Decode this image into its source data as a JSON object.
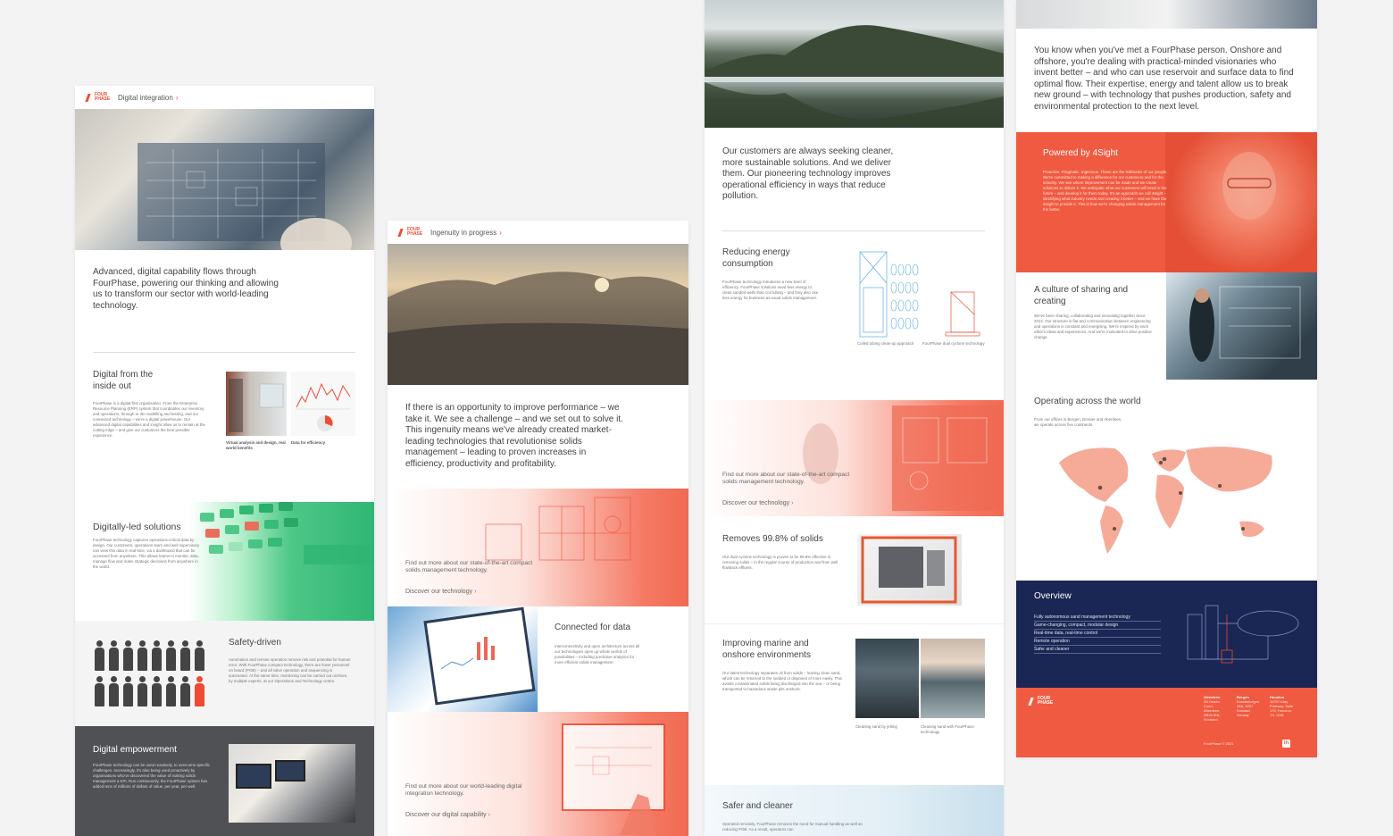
{
  "brand": {
    "logo_text": "FOUR PHASE",
    "accent": "#ee4b33",
    "navy": "#1a2653"
  },
  "col1": {
    "crumb": "Digital integration",
    "lead": "Advanced, digital capability flows through FourPhase, powering our thinking and allowing us to transform our sector with world-leading technology.",
    "digital_inside": {
      "title": "Digital from the inside out",
      "body": "FourPhase is a digital-first organisation. From the Enterprise Resource Planning (ERP) system that coordinates our inventory and operations, through to 3D modelling and testing, and our connected technology – we're a digital powerhouse. Our advanced digital capabilities and insight allow us to remain at the cutting edge – and give our customers the best possible experience.",
      "caption1_title": "Virtual analysis and design, real world benefits",
      "caption2_title": "Data for efficiency"
    },
    "solutions": {
      "title": "Digitally-led solutions",
      "body": "FourPhase technology captures operations-critical data by design. Our customers, operations team and well supervisory can view this data in real-time, via a dashboard that can be accessed from anywhere. This allows teams to monitor, data, manage flow and make strategic decisions from anywhere in the world."
    },
    "safety": {
      "title": "Safety-driven",
      "body": "Automation and remote operation remove risk and potential for human error. With FourPhase compact technology, there are fewer personnel on board (POB) – and all valve operation and sequencing is automated. At the same time, monitoring can be carried out onshore, by multiple experts, at our Operations and Technology centre."
    },
    "empowerment": {
      "title": "Digital empowerment",
      "body": "FourPhase technology can be used reactively, to overcome specific challenges. Increasingly, it's also being used proactively by organisations who've discovered the value of making solids management a KPI. Run continuously, the FourPhase system has added tens of millions of dollars of value, per year, per well."
    }
  },
  "col2": {
    "crumb": "Ingenuity in progress",
    "lead": "If there is an opportunity to improve performance – we take it. We see a challenge – and we set out to solve it. This ingenuity means we've already created market-leading technologies that revolutionise solids management – leading to proven increases in efficiency, productivity and profitability.",
    "promo1": {
      "text": "Find out more about our state-of-the-art compact solids management technology.",
      "link": "Discover our technology"
    },
    "connected": {
      "title": "Connected for data",
      "body": "Interconnectivity and open architecture across all our technologies open up whole worlds of possibilities – including predictive analytics for more efficient solids management."
    },
    "promo2": {
      "text": "Find out more about our world-leading digital integration technology.",
      "link": "Discover our digital capability"
    }
  },
  "col3": {
    "lead": "Our customers are always seeking cleaner, more sustainable solutions. And we deliver them. Our pioneering technology improves operational efficiency in ways that reduce pollution.",
    "energy": {
      "title": "Reducing energy consumption",
      "body": "FourPhase technology introduces a new level of efficiency. FourPhase solutions need less energy to clean sanded wells than coil tubing – and they also use less energy for business-as-usual solids management.",
      "diagram1_label": "Coiled tubing clean-up approach",
      "diagram2_label": "FourPhase dual cyclone technology"
    },
    "promo": {
      "text": "Find out more about our state-of-the-art compact solids management technology.",
      "link": "Discover our technology"
    },
    "removes": {
      "title": "Removes 99.8% of solids",
      "body": "Our dual cyclone technology is proven to be 99.8% effective in removing solids – in the regular course of production and from well flowback effluent."
    },
    "marine": {
      "title": "Improving marine and onshore environments",
      "body": "Our latest technology separates oil from solids – leaving clean sand, which can be returned to the seabed or disposed of more easily. This avoids contaminated solids being discharged into the sea – or being transported to hazardous waste pits onshore.",
      "caption1": "Cleaning sand by jetting",
      "caption2": "Cleaning sand with FourPhase technology"
    },
    "safer": {
      "title": "Safer and cleaner",
      "body": "Operated remotely, FourPhase removes the need for manual handling as well as reducing POB. As a result, operators can"
    }
  },
  "col4": {
    "lead": "You know when you've met a FourPhase person. Onshore and offshore, you're dealing with practical-minded visionaries who invent better – and who can use reservoir and surface data to find optimal flow. Their expertise, energy and talent allow us to break new ground – with technology that pushes production, safety and environmental protection to the next level.",
    "powered": {
      "title": "Powered by 4Sight",
      "body": "Proactive. Pragmatic. Ingenious. These are the hallmarks of our people. We're committed to making a difference for our customers and for the industry. We see where improvement can be made and we create solutions to deliver it. We anticipate what our customers will need in the future – and develop it for them today. It's an approach we call 4Sight – identifying what industry needs and creating it better – and we have the insight to provide it. This is how we're changing solids management for the better."
    },
    "culture": {
      "title": "A culture of sharing and creating",
      "body": "We've been sharing, collaborating and innovating together since 2012. Our structure is flat and communication between engineering and operations is constant and energising. We're inspired by each other's ideas and experiences. And we're motivated to drive positive change."
    },
    "world": {
      "title": "Operating across the world",
      "body": "From our offices in Bergen, Bossier and Aberdeen, we operate across five continents."
    },
    "overview": {
      "title": "Overview",
      "items": [
        "Fully autonomous sand management technology",
        "Game-changing, compact, modular design",
        "Real-time data, real-time control",
        "Remote operation",
        "Safer and cleaner"
      ]
    },
    "footer": {
      "offices": [
        {
          "city": "Aberdeen",
          "lines": "2B Ocean Court, Aberdeen, AB23 8NL, Scotland"
        },
        {
          "city": "Bergen",
          "lines": "Kokstadvegen 28A, 5257 Kokstad, Norway"
        },
        {
          "city": "Houston",
          "lines": "10707 Katy Freeway, Suite 170, Houston, TX, USA"
        }
      ],
      "legal": "FourPhase © 2021",
      "linkedin": "in"
    }
  }
}
